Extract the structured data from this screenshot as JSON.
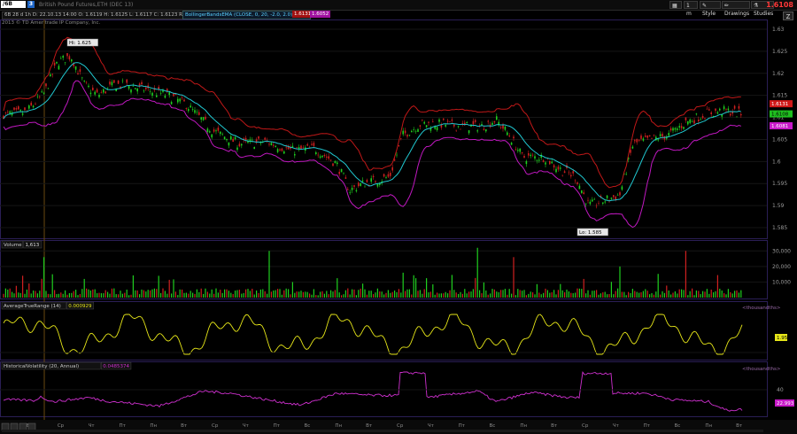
{
  "toolbar": {
    "symbol": "/6B",
    "link_number": "3",
    "product_name": "British Pound Futures,ETH (DEC 13)",
    "timeframe": "1 m",
    "style": "Style",
    "drawings": "Drawings",
    "studies": "Studies",
    "last_price": "1.6108"
  },
  "quote_strip": {
    "ohlc": "6B 28 d 1h  D: 22.10.13 14:00  O: 1.6119   H: 1.6125   L: 1.6117   C: 1.6123   R: 0.0008",
    "bollinger": "BollingerBandsEMA (CLOSE, 0, 20, -2.0, 2.0)  1.613",
    "bb_upper": "1.6131",
    "bb_lower": "1.6052"
  },
  "copyright": "2013 © TD Ameritrade IP Company, Inc.",
  "price_panel": {
    "ticks": [
      "1.63",
      "1.625",
      "1.62",
      "1.615",
      "1.61",
      "1.605",
      "1.6",
      "1.595",
      "1.59",
      "1.585"
    ],
    "hi_label": "Hi: 1.625",
    "lo_label": "Lo: 1.585",
    "tag_red": "1.6131",
    "tag_green": "1.6108",
    "tag_magenta": "1.6081"
  },
  "volume_panel": {
    "label": "Volume",
    "value": "1,613",
    "ticks": [
      "30,000",
      "20,000",
      "10,000"
    ]
  },
  "atr_panel": {
    "label": "AverageTrueRange (14)",
    "value": "0.000929",
    "tag": "1.95",
    "right_label": "<thousandths>"
  },
  "hv_panel": {
    "label": "HistoricalVolatility (20, Annual)",
    "value": "0.0485374",
    "tick": "40",
    "tag": "22.993",
    "right_label": "<thousandths>"
  },
  "xaxis": [
    "Вт",
    "Ср",
    "Чт",
    "Пт",
    "Пн",
    "Вт",
    "Ср",
    "Чт",
    "Пт",
    "Вс",
    "Пн",
    "Вт",
    "Ср",
    "Чт",
    "Пт",
    "Вс",
    "Пн",
    "Вт",
    "Ср",
    "Чт",
    "Пт",
    "Вс",
    "Пн",
    "Вт"
  ],
  "colors": {
    "upper_band": "#c01818",
    "lower_band": "#c018c0",
    "mid_band": "#20c8d0",
    "candle_up": "#1fcf1f",
    "candle_down": "#d02020",
    "atr_line": "#e6e618",
    "hv_line": "#d030d0"
  }
}
